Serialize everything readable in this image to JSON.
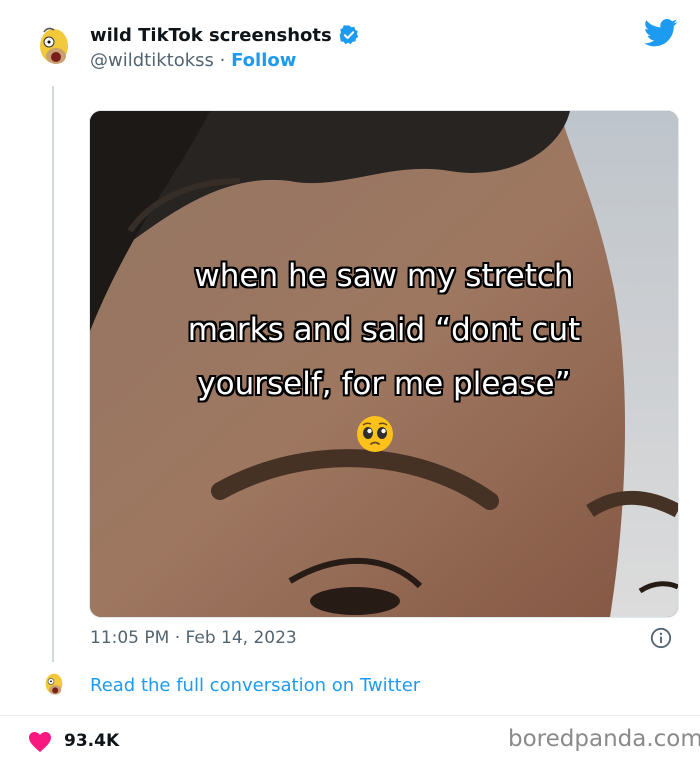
{
  "account": {
    "display_name": "wild TikTok screenshots",
    "handle": "@wildtiktokss",
    "separator": "·",
    "follow_label": "Follow"
  },
  "media": {
    "caption_lines": [
      "when he saw my stretch",
      "marks and said “dont cut",
      "yourself, for me please”"
    ],
    "emoji": "pleading-face"
  },
  "tweet": {
    "timestamp": "11:05 PM · Feb 14, 2023"
  },
  "thread": {
    "read_link": "Read the full conversation on Twitter"
  },
  "footer": {
    "likes": "93.4K",
    "brand": "boredpanda.com"
  },
  "icons": {
    "twitter": "twitter-bird-icon",
    "verified": "verified-badge-icon",
    "info": "info-icon",
    "heart": "heart-icon"
  },
  "colors": {
    "link": "#1d9bf0",
    "heart": "#f91880",
    "muted": "#536471"
  }
}
